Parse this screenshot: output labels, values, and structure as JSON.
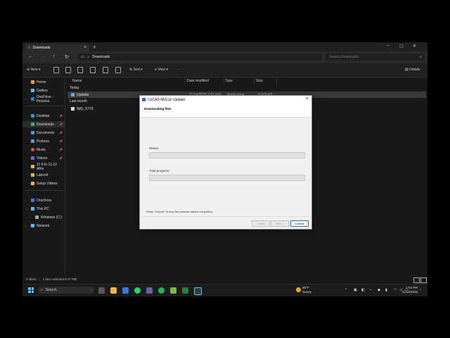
{
  "window": {
    "tab_title": "Downloads",
    "address": "Downloads",
    "search_placeholder": "Search Downloads",
    "toolbar": {
      "new": "New",
      "sort": "Sort",
      "view": "View",
      "more": "···",
      "details": "Details"
    }
  },
  "sidebar": {
    "items": [
      {
        "label": "Home"
      },
      {
        "label": "Gallery"
      },
      {
        "label": "OneDrive - Persona"
      },
      {
        "label": "Desktop"
      },
      {
        "label": "Downloads"
      },
      {
        "label": "Documents"
      },
      {
        "label": "Pictures"
      },
      {
        "label": "Music"
      },
      {
        "label": "Videos"
      },
      {
        "label": "11-9 to 11-12 Alfre"
      },
      {
        "label": "Labvolt"
      },
      {
        "label": "Setup Videos"
      },
      {
        "label": "OneDrive"
      },
      {
        "label": "This PC"
      },
      {
        "label": "Windows (C:)"
      },
      {
        "label": "Network"
      }
    ]
  },
  "files": {
    "columns": [
      "Name",
      "Date modified",
      "Type",
      "Size"
    ],
    "groups": [
      {
        "label": "Today",
        "rows": [
          {
            "name": "Updater",
            "date": "11/14/2025 1:01 PM",
            "type": "Application",
            "size": "8,479 KB"
          }
        ]
      },
      {
        "label": "Last month",
        "rows": [
          {
            "name": "IMG_5779",
            "date": "",
            "type": "",
            "size": ""
          }
        ]
      }
    ]
  },
  "status": {
    "count": "2 items",
    "selected": "1 item selected 8.27 MB"
  },
  "dialog": {
    "title": "LUCAS-NÜLLE Updater",
    "heading": "Downloading files",
    "status_label": "Status:",
    "status_progress": 0,
    "total_label": "Total progress:",
    "total_progress": 0,
    "hint": "Press \"Cancel\" to stop the process before completion.",
    "back": "< Back",
    "next": "Next >",
    "cancel": "Cancel"
  },
  "taskbar": {
    "search": "Search",
    "temp": "68°F",
    "weather": "Sunny",
    "time": "1:04 PM",
    "date": "11/14/2025"
  },
  "colors": {
    "accent": "#4cc2ff",
    "dialog_primary": "#2a70c8",
    "taskbar": "#1c1c1c"
  }
}
